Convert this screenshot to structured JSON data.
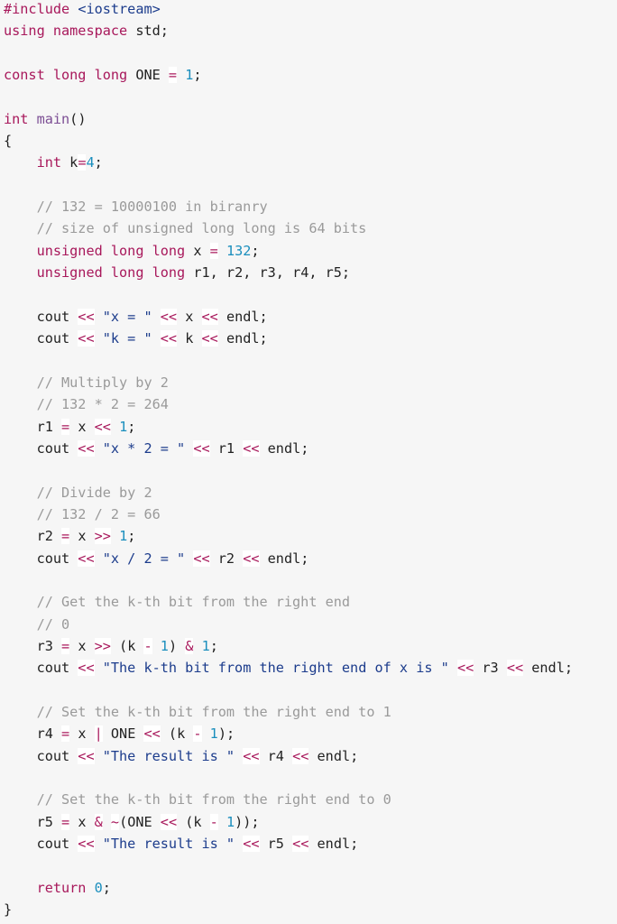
{
  "document": {
    "language": "cpp",
    "colors": {
      "background": "#f6f6f6",
      "keyword": "#a8185b",
      "function": "#7c4e94",
      "number": "#1a8ebd",
      "string": "#1c3c8c",
      "comment": "#9a9a9a",
      "plain": "#222222"
    },
    "lines": [
      [
        {
          "t": "kw",
          "v": "#include"
        },
        {
          "t": "pl",
          "v": " "
        },
        {
          "t": "inc",
          "v": "<iostream>"
        }
      ],
      [
        {
          "t": "kw",
          "v": "using"
        },
        {
          "t": "pl",
          "v": " "
        },
        {
          "t": "kw",
          "v": "namespace"
        },
        {
          "t": "pl",
          "v": " std;"
        }
      ],
      [],
      [
        {
          "t": "kw",
          "v": "const"
        },
        {
          "t": "pl",
          "v": " "
        },
        {
          "t": "kw",
          "v": "long"
        },
        {
          "t": "pl",
          "v": " "
        },
        {
          "t": "kw",
          "v": "long"
        },
        {
          "t": "pl",
          "v": " ONE "
        },
        {
          "t": "op",
          "v": "="
        },
        {
          "t": "pl",
          "v": " "
        },
        {
          "t": "num",
          "v": "1"
        },
        {
          "t": "pl",
          "v": ";"
        }
      ],
      [],
      [
        {
          "t": "kw",
          "v": "int"
        },
        {
          "t": "pl",
          "v": " "
        },
        {
          "t": "fn",
          "v": "main"
        },
        {
          "t": "pl",
          "v": "()"
        }
      ],
      [
        {
          "t": "pl",
          "v": "{"
        }
      ],
      [
        {
          "t": "pl",
          "v": "    "
        },
        {
          "t": "kw",
          "v": "int"
        },
        {
          "t": "pl",
          "v": " k"
        },
        {
          "t": "op",
          "v": "="
        },
        {
          "t": "num",
          "v": "4"
        },
        {
          "t": "pl",
          "v": ";"
        }
      ],
      [],
      [
        {
          "t": "pl",
          "v": "    "
        },
        {
          "t": "cm",
          "v": "// 132 = 10000100 in biranry"
        }
      ],
      [
        {
          "t": "pl",
          "v": "    "
        },
        {
          "t": "cm",
          "v": "// size of unsigned long long is 64 bits"
        }
      ],
      [
        {
          "t": "pl",
          "v": "    "
        },
        {
          "t": "kw",
          "v": "unsigned"
        },
        {
          "t": "pl",
          "v": " "
        },
        {
          "t": "kw",
          "v": "long"
        },
        {
          "t": "pl",
          "v": " "
        },
        {
          "t": "kw",
          "v": "long"
        },
        {
          "t": "pl",
          "v": " x "
        },
        {
          "t": "op",
          "v": "="
        },
        {
          "t": "pl",
          "v": " "
        },
        {
          "t": "num",
          "v": "132"
        },
        {
          "t": "pl",
          "v": ";"
        }
      ],
      [
        {
          "t": "pl",
          "v": "    "
        },
        {
          "t": "kw",
          "v": "unsigned"
        },
        {
          "t": "pl",
          "v": " "
        },
        {
          "t": "kw",
          "v": "long"
        },
        {
          "t": "pl",
          "v": " "
        },
        {
          "t": "kw",
          "v": "long"
        },
        {
          "t": "pl",
          "v": " r1, r2, r3, r4, r5;"
        }
      ],
      [],
      [
        {
          "t": "pl",
          "v": "    cout "
        },
        {
          "t": "op",
          "v": "<<"
        },
        {
          "t": "pl",
          "v": " "
        },
        {
          "t": "str",
          "v": "\"x = \""
        },
        {
          "t": "pl",
          "v": " "
        },
        {
          "t": "op",
          "v": "<<"
        },
        {
          "t": "pl",
          "v": " x "
        },
        {
          "t": "op",
          "v": "<<"
        },
        {
          "t": "pl",
          "v": " endl;"
        }
      ],
      [
        {
          "t": "pl",
          "v": "    cout "
        },
        {
          "t": "op",
          "v": "<<"
        },
        {
          "t": "pl",
          "v": " "
        },
        {
          "t": "str",
          "v": "\"k = \""
        },
        {
          "t": "pl",
          "v": " "
        },
        {
          "t": "op",
          "v": "<<"
        },
        {
          "t": "pl",
          "v": " k "
        },
        {
          "t": "op",
          "v": "<<"
        },
        {
          "t": "pl",
          "v": " endl;"
        }
      ],
      [],
      [
        {
          "t": "pl",
          "v": "    "
        },
        {
          "t": "cm",
          "v": "// Multiply by 2"
        }
      ],
      [
        {
          "t": "pl",
          "v": "    "
        },
        {
          "t": "cm",
          "v": "// 132 * 2 = 264"
        }
      ],
      [
        {
          "t": "pl",
          "v": "    r1 "
        },
        {
          "t": "op",
          "v": "="
        },
        {
          "t": "pl",
          "v": " x "
        },
        {
          "t": "op",
          "v": "<<"
        },
        {
          "t": "pl",
          "v": " "
        },
        {
          "t": "num",
          "v": "1"
        },
        {
          "t": "pl",
          "v": ";"
        }
      ],
      [
        {
          "t": "pl",
          "v": "    cout "
        },
        {
          "t": "op",
          "v": "<<"
        },
        {
          "t": "pl",
          "v": " "
        },
        {
          "t": "str",
          "v": "\"x * 2 = \""
        },
        {
          "t": "pl",
          "v": " "
        },
        {
          "t": "op",
          "v": "<<"
        },
        {
          "t": "pl",
          "v": " r1 "
        },
        {
          "t": "op",
          "v": "<<"
        },
        {
          "t": "pl",
          "v": " endl;"
        }
      ],
      [],
      [
        {
          "t": "pl",
          "v": "    "
        },
        {
          "t": "cm",
          "v": "// Divide by 2"
        }
      ],
      [
        {
          "t": "pl",
          "v": "    "
        },
        {
          "t": "cm",
          "v": "// 132 / 2 = 66"
        }
      ],
      [
        {
          "t": "pl",
          "v": "    r2 "
        },
        {
          "t": "op",
          "v": "="
        },
        {
          "t": "pl",
          "v": " x "
        },
        {
          "t": "op",
          "v": ">>"
        },
        {
          "t": "pl",
          "v": " "
        },
        {
          "t": "num",
          "v": "1"
        },
        {
          "t": "pl",
          "v": ";"
        }
      ],
      [
        {
          "t": "pl",
          "v": "    cout "
        },
        {
          "t": "op",
          "v": "<<"
        },
        {
          "t": "pl",
          "v": " "
        },
        {
          "t": "str",
          "v": "\"x / 2 = \""
        },
        {
          "t": "pl",
          "v": " "
        },
        {
          "t": "op",
          "v": "<<"
        },
        {
          "t": "pl",
          "v": " r2 "
        },
        {
          "t": "op",
          "v": "<<"
        },
        {
          "t": "pl",
          "v": " endl;"
        }
      ],
      [],
      [
        {
          "t": "pl",
          "v": "    "
        },
        {
          "t": "cm",
          "v": "// Get the k-th bit from the right end"
        }
      ],
      [
        {
          "t": "pl",
          "v": "    "
        },
        {
          "t": "cm",
          "v": "// 0"
        }
      ],
      [
        {
          "t": "pl",
          "v": "    r3 "
        },
        {
          "t": "op",
          "v": "="
        },
        {
          "t": "pl",
          "v": " x "
        },
        {
          "t": "op",
          "v": ">>"
        },
        {
          "t": "pl",
          "v": " (k "
        },
        {
          "t": "op",
          "v": "-"
        },
        {
          "t": "pl",
          "v": " "
        },
        {
          "t": "num",
          "v": "1"
        },
        {
          "t": "pl",
          "v": ") "
        },
        {
          "t": "op",
          "v": "&"
        },
        {
          "t": "pl",
          "v": " "
        },
        {
          "t": "num",
          "v": "1"
        },
        {
          "t": "pl",
          "v": ";"
        }
      ],
      [
        {
          "t": "pl",
          "v": "    cout "
        },
        {
          "t": "op",
          "v": "<<"
        },
        {
          "t": "pl",
          "v": " "
        },
        {
          "t": "str",
          "v": "\"The k-th bit from the right end of x is \""
        },
        {
          "t": "pl",
          "v": " "
        },
        {
          "t": "op",
          "v": "<<"
        },
        {
          "t": "pl",
          "v": " r3 "
        },
        {
          "t": "op",
          "v": "<<"
        },
        {
          "t": "pl",
          "v": " endl;"
        }
      ],
      [],
      [
        {
          "t": "pl",
          "v": "    "
        },
        {
          "t": "cm",
          "v": "// Set the k-th bit from the right end to 1"
        }
      ],
      [
        {
          "t": "pl",
          "v": "    r4 "
        },
        {
          "t": "op",
          "v": "="
        },
        {
          "t": "pl",
          "v": " x "
        },
        {
          "t": "op",
          "v": "|"
        },
        {
          "t": "pl",
          "v": " ONE "
        },
        {
          "t": "op",
          "v": "<<"
        },
        {
          "t": "pl",
          "v": " (k "
        },
        {
          "t": "op",
          "v": "-"
        },
        {
          "t": "pl",
          "v": " "
        },
        {
          "t": "num",
          "v": "1"
        },
        {
          "t": "pl",
          "v": ");"
        }
      ],
      [
        {
          "t": "pl",
          "v": "    cout "
        },
        {
          "t": "op",
          "v": "<<"
        },
        {
          "t": "pl",
          "v": " "
        },
        {
          "t": "str",
          "v": "\"The result is \""
        },
        {
          "t": "pl",
          "v": " "
        },
        {
          "t": "op",
          "v": "<<"
        },
        {
          "t": "pl",
          "v": " r4 "
        },
        {
          "t": "op",
          "v": "<<"
        },
        {
          "t": "pl",
          "v": " endl;"
        }
      ],
      [],
      [
        {
          "t": "pl",
          "v": "    "
        },
        {
          "t": "cm",
          "v": "// Set the k-th bit from the right end to 0"
        }
      ],
      [
        {
          "t": "pl",
          "v": "    r5 "
        },
        {
          "t": "op",
          "v": "="
        },
        {
          "t": "pl",
          "v": " x "
        },
        {
          "t": "op",
          "v": "&"
        },
        {
          "t": "pl",
          "v": " "
        },
        {
          "t": "op",
          "v": "~"
        },
        {
          "t": "pl",
          "v": "(ONE "
        },
        {
          "t": "op",
          "v": "<<"
        },
        {
          "t": "pl",
          "v": " (k "
        },
        {
          "t": "op",
          "v": "-"
        },
        {
          "t": "pl",
          "v": " "
        },
        {
          "t": "num",
          "v": "1"
        },
        {
          "t": "pl",
          "v": "));"
        }
      ],
      [
        {
          "t": "pl",
          "v": "    cout "
        },
        {
          "t": "op",
          "v": "<<"
        },
        {
          "t": "pl",
          "v": " "
        },
        {
          "t": "str",
          "v": "\"The result is \""
        },
        {
          "t": "pl",
          "v": " "
        },
        {
          "t": "op",
          "v": "<<"
        },
        {
          "t": "pl",
          "v": " r5 "
        },
        {
          "t": "op",
          "v": "<<"
        },
        {
          "t": "pl",
          "v": " endl;"
        }
      ],
      [],
      [
        {
          "t": "pl",
          "v": "    "
        },
        {
          "t": "kw",
          "v": "return"
        },
        {
          "t": "pl",
          "v": " "
        },
        {
          "t": "num",
          "v": "0"
        },
        {
          "t": "pl",
          "v": ";"
        }
      ],
      [
        {
          "t": "pl",
          "v": "}"
        }
      ]
    ]
  }
}
